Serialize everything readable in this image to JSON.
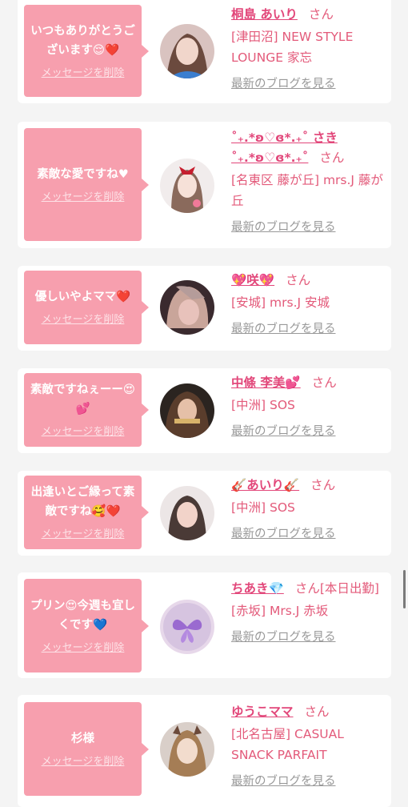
{
  "delete_label": "メッセージを削除",
  "blog_label": "最新のブログを見る",
  "san_label": "さん",
  "entries": [
    {
      "message": "いつもありがとうございます😌❤️",
      "name": "桐島 あいり",
      "store": "[津田沼] NEW STYLE LOUNGE 家忘"
    },
    {
      "message": "素敵な愛ですね♥",
      "name": "˚₊.*ʚ♡ɞ*.₊˚ さき˚₊.*ʚ♡ɞ*.₊˚",
      "store": "[名東区 藤が丘] mrs.J 藤が丘"
    },
    {
      "message": "優しいやよママ❤️",
      "name": "💖咲💖",
      "store": "[安城] mrs.J 安城"
    },
    {
      "message": "素敵ですねぇーー😍💕",
      "name": "中條 李美💕",
      "store": "[中洲] SOS"
    },
    {
      "message": "出逢いとご縁って素敵ですね🥰❤️",
      "name": "🎸あいり🎸",
      "store": "[中洲] SOS"
    },
    {
      "message": "プリン😍今週も宜しくです💙",
      "name": "ちあき💎",
      "suffix": "[本日出勤]",
      "store": "[赤坂] Mrs.J 赤坂"
    },
    {
      "message": "杉様",
      "name": "ゆうこママ",
      "store": "[北名古屋] CASUAL SNACK PARFAIT"
    }
  ],
  "colors": {
    "bubble": "#f79fae",
    "accent": "#e2477a",
    "background": "#f4f4f4"
  }
}
